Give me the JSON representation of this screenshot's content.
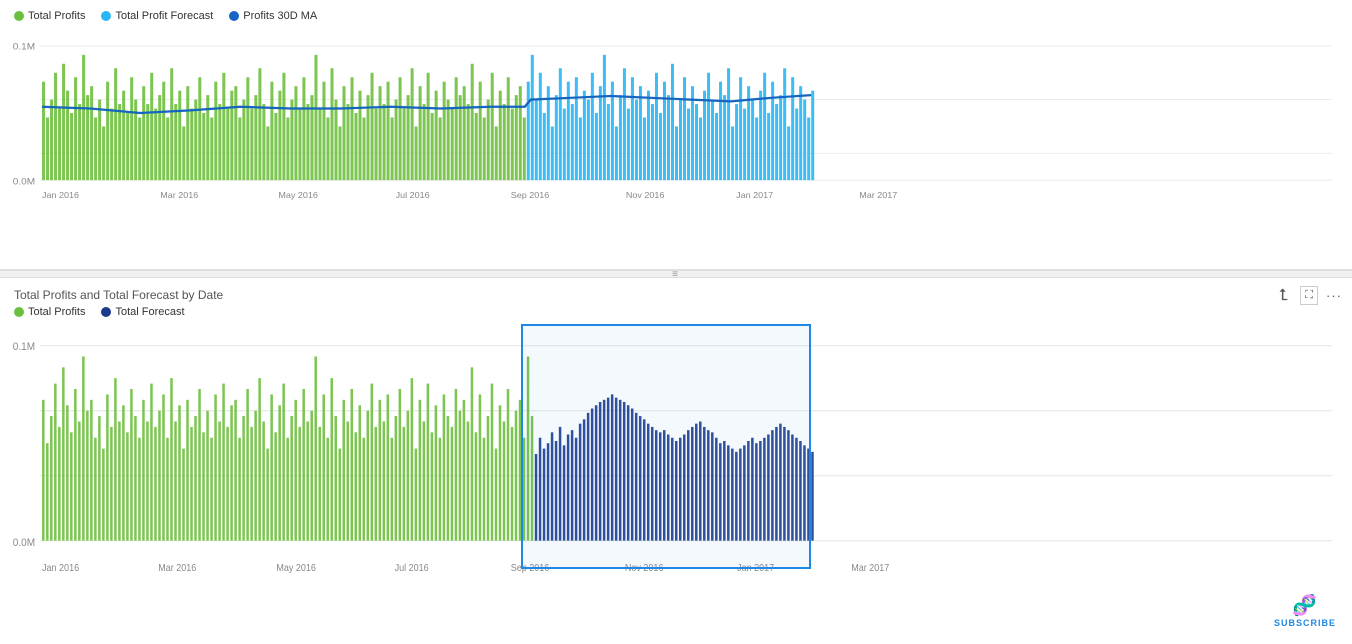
{
  "topChart": {
    "legend": [
      {
        "label": "Total Profits",
        "color": "#6dbf3e",
        "type": "bar"
      },
      {
        "label": "Total Profit Forecast",
        "color": "#29b6f6",
        "type": "bar"
      },
      {
        "label": "Profits 30D MA",
        "color": "#1565c0",
        "type": "line"
      }
    ],
    "yAxisLabels": [
      "0.1M",
      "0.0M"
    ],
    "xAxisLabels": [
      "Jan 2016",
      "Mar 2016",
      "May 2016",
      "Jul 2016",
      "Sep 2016",
      "Nov 2016",
      "Jan 2017",
      "Mar 2017"
    ],
    "dragHandleChar": "≡"
  },
  "bottomChart": {
    "title": "Total Profits and Total Forecast by Date",
    "legend": [
      {
        "label": "Total Profits",
        "color": "#6dbf3e",
        "type": "bar"
      },
      {
        "label": "Total Forecast",
        "color": "#1a3a8f",
        "type": "bar"
      }
    ],
    "yAxisLabels": [
      "0.1M",
      "0.0M"
    ],
    "xAxisLabels": [
      "Jan 2016",
      "Mar 2016",
      "May 2016",
      "Jul 2016",
      "Sep 2016",
      "Nov 2016",
      "Jan 2017",
      "Mar 2017"
    ],
    "controls": {
      "expandIcon": "⛶",
      "moreIcon": "..."
    }
  },
  "subscribe": {
    "label": "SUBSCRIBE",
    "icon": "🧬"
  }
}
